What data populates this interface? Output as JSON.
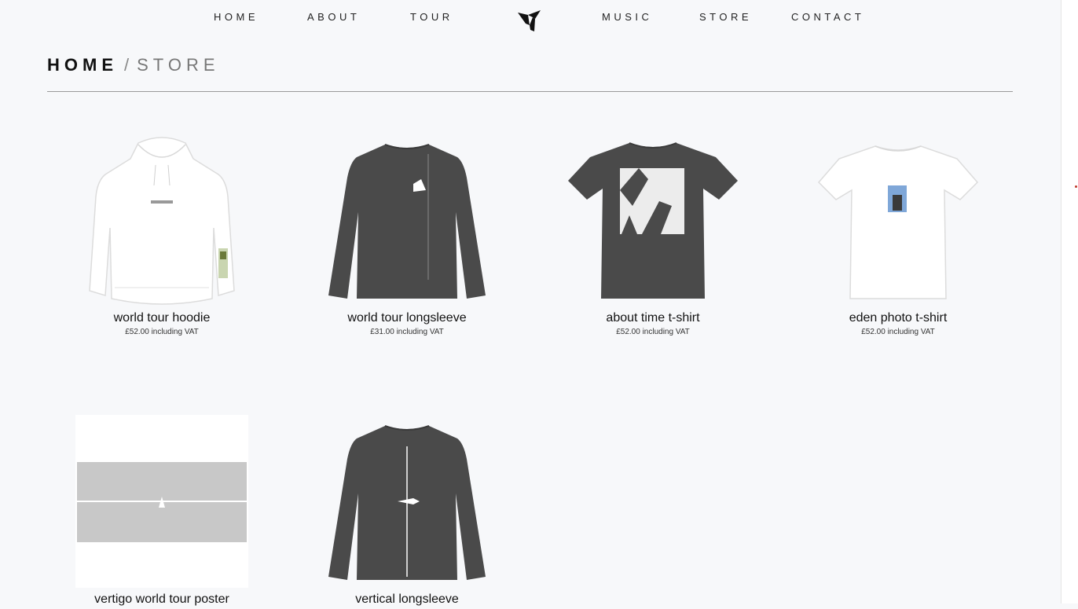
{
  "nav": {
    "left": [
      "HOME",
      "ABOUT",
      "TOUR"
    ],
    "right": [
      "MUSIC",
      "STORE",
      "CONTACT"
    ]
  },
  "breadcrumb": {
    "home": "HOME",
    "separator": "/",
    "current": "STORE"
  },
  "products": [
    {
      "name": "world tour hoodie",
      "price": "£52.00 including VAT",
      "image": "white-hoodie"
    },
    {
      "name": "world tour longsleeve",
      "price": "£31.00 including VAT",
      "image": "charcoal-longsleeve"
    },
    {
      "name": "about time t-shirt",
      "price": "£52.00 including VAT",
      "image": "charcoal-tshirt"
    },
    {
      "name": "eden photo t-shirt",
      "price": "£52.00 including VAT",
      "image": "white-tshirt"
    },
    {
      "name": "vertigo world tour poster",
      "price": "",
      "image": "poster"
    },
    {
      "name": "vertical longsleeve",
      "price": "",
      "image": "charcoal-longsleeve-vertical"
    }
  ],
  "colors": {
    "background": "#f7f8fa",
    "charcoal": "#4a4a4a",
    "text": "#111111"
  }
}
